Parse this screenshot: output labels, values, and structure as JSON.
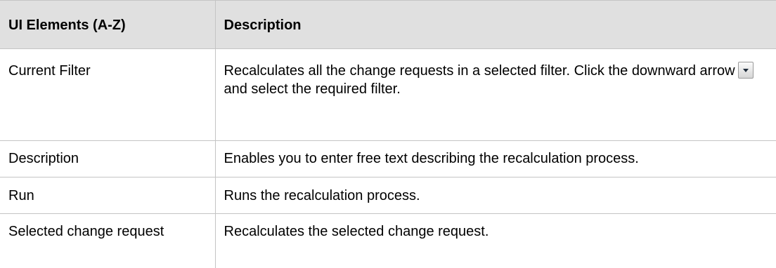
{
  "table": {
    "headers": [
      "UI Elements (A-Z)",
      "Description"
    ],
    "rows": [
      {
        "element": "Current Filter",
        "description_before_icon": "Recalculates all the change requests in a selected filter. Click the downward arrow",
        "description_icon": "dropdown-arrow-icon",
        "description_after_icon": "and select the required filter."
      },
      {
        "element": "Description",
        "description": "Enables you to enter free text describing the recalculation process."
      },
      {
        "element": "Run",
        "description": "Runs the recalculation process."
      },
      {
        "element": "Selected change request",
        "description": "Recalculates the selected change request."
      }
    ]
  },
  "colors": {
    "header_background": "#e0e0e0",
    "border": "#c4c4c4"
  }
}
